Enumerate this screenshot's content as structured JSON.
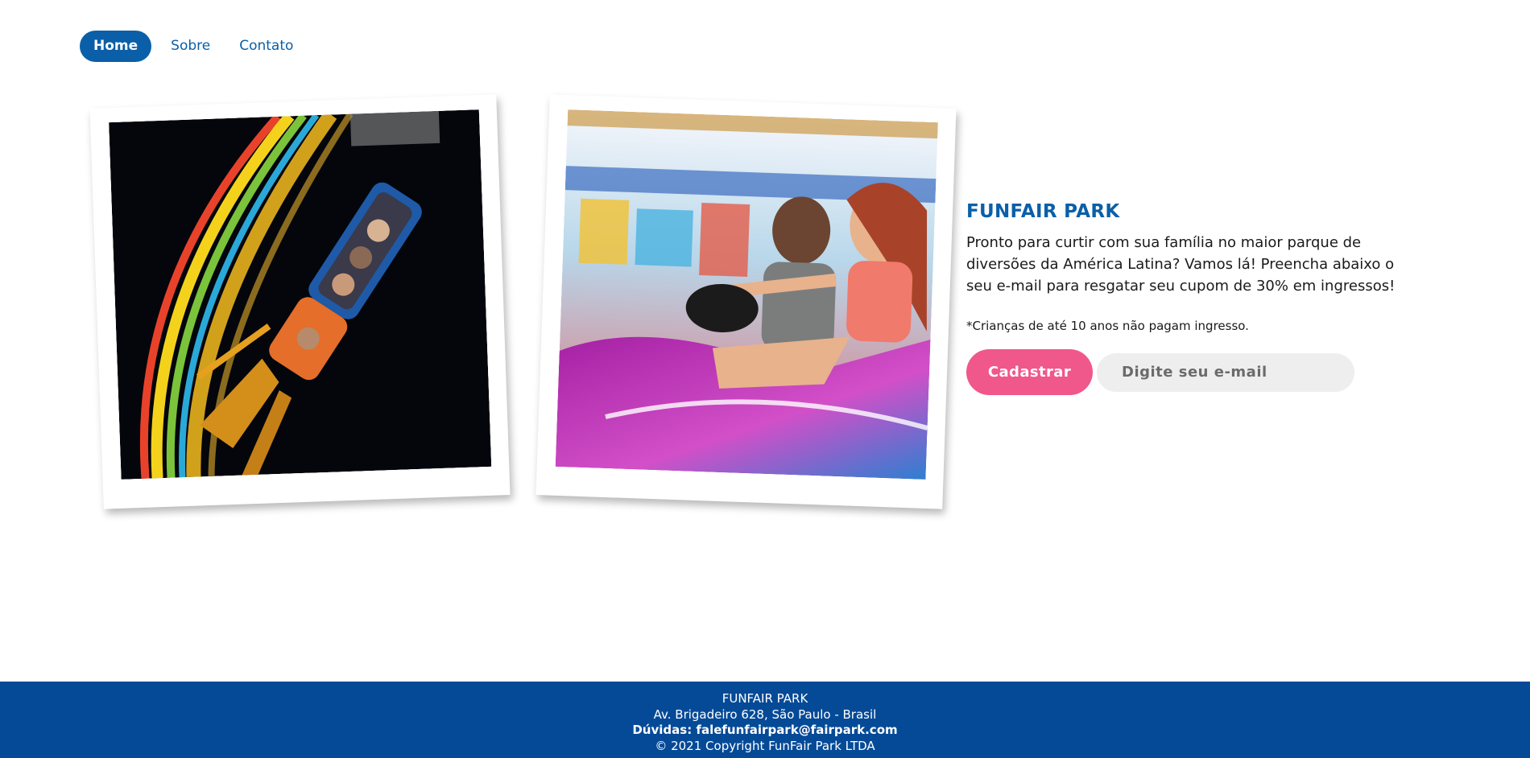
{
  "nav": {
    "items": [
      {
        "label": "Home",
        "active": true
      },
      {
        "label": "Sobre",
        "active": false
      },
      {
        "label": "Contato",
        "active": false
      }
    ]
  },
  "photos": [
    {
      "subject": "roller-coaster-loop"
    },
    {
      "subject": "bumper-car-couple"
    }
  ],
  "promo": {
    "title": "FUNFAIR PARK",
    "intro": "Pronto para curtir com sua família no maior parque de diversões da América Latina? Vamos lá! Preencha abaixo o seu e-mail para resgatar seu cupom de 30% em ingressos!",
    "note": "*Crianças de até 10 anos não pagam ingresso.",
    "button_label": "Cadastrar",
    "email_placeholder": "Digite seu e-mail",
    "email_value": ""
  },
  "footer": {
    "name": "FUNFAIR PARK",
    "address": "Av. Brigadeiro 628, São Paulo - Brasil",
    "contact": "Dúvidas: falefunfairpark@fairpark.com",
    "copyright": "© 2021 Copyright FunFair Park LTDA"
  },
  "colors": {
    "brand_blue": "#0a5fa8",
    "footer_blue": "#054a97",
    "button_pink": "#f0578a",
    "input_bg": "#eeeeee"
  }
}
